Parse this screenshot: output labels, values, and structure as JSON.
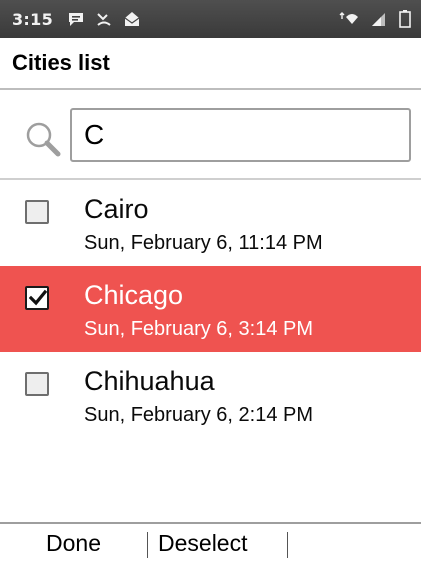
{
  "status_bar": {
    "time": "3:15",
    "left_icons": [
      "message-icon",
      "missed-call-icon",
      "email-icon"
    ],
    "right_icons": [
      "wifi-data-icon",
      "signal-icon",
      "battery-icon"
    ]
  },
  "header": {
    "title": "Cities list"
  },
  "search": {
    "value": "C",
    "icon": "search-icon"
  },
  "cities": [
    {
      "name": "Cairo",
      "time": "Sun, February 6, 11:14 PM",
      "checked": false,
      "selected": false
    },
    {
      "name": "Chicago",
      "time": "Sun, February 6, 3:14 PM",
      "checked": true,
      "selected": true
    },
    {
      "name": "Chihuahua",
      "time": "Sun, February 6, 2:14 PM",
      "checked": false,
      "selected": false
    }
  ],
  "softkeys": {
    "left": "Done",
    "center": "Deselect",
    "right": ""
  },
  "colors": {
    "selection": "#ef5350",
    "status_bar": "#444444"
  }
}
